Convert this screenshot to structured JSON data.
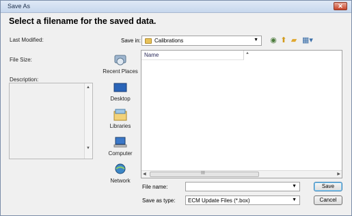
{
  "window": {
    "title": "Save As",
    "close_label": "✕"
  },
  "heading": "Select a filename for the saved data.",
  "left_panel": {
    "last_modified_label": "Last Modified:",
    "file_size_label": "File Size:",
    "description_label": "Description:"
  },
  "toolbar": {
    "save_in_label": "Save in:",
    "save_in_value": "Calibrations",
    "icons": [
      "back-icon",
      "up-folder-icon",
      "new-folder-icon",
      "view-menu-icon"
    ]
  },
  "places": [
    {
      "label": "Recent Places",
      "icon": "recent-places-icon"
    },
    {
      "label": "Desktop",
      "icon": "desktop-icon"
    },
    {
      "label": "Libraries",
      "icon": "libraries-icon"
    },
    {
      "label": "Computer",
      "icon": "computer-icon"
    },
    {
      "label": "Network",
      "icon": "network-icon"
    }
  ],
  "file_list": {
    "column_name": "Name",
    "rows": [],
    "scroll_grip": "III"
  },
  "file_name": {
    "label": "File name:",
    "value": ""
  },
  "save_as_type": {
    "label": "Save as type:",
    "value": "ECM Update Files (*.box)"
  },
  "buttons": {
    "save": "Save",
    "cancel": "Cancel"
  }
}
